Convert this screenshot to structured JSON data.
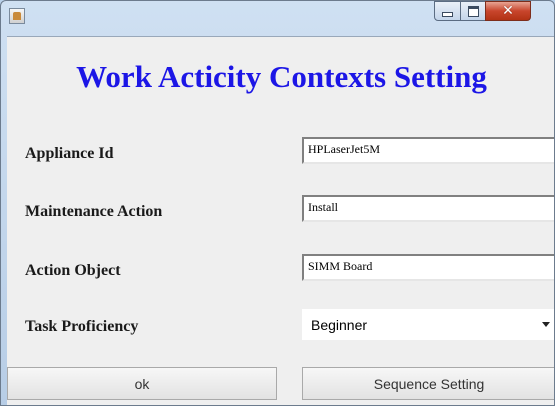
{
  "window": {
    "controls": {
      "minimize_icon": "minimize-icon",
      "maximize_icon": "maximize-icon",
      "close_icon": "close-icon",
      "close_glyph": "✕"
    }
  },
  "form": {
    "title": "Work Acticity Contexts Setting",
    "appliance_id": {
      "label": "Appliance Id",
      "value": "HPLaserJet5M"
    },
    "maintenance_action": {
      "label": "Maintenance Action",
      "value": "Install"
    },
    "action_object": {
      "label": "Action Object",
      "value": "SIMM Board"
    },
    "task_proficiency": {
      "label": "Task Proficiency",
      "selected": "Beginner"
    }
  },
  "buttons": {
    "ok": "ok",
    "sequence_setting": "Sequence Setting"
  }
}
